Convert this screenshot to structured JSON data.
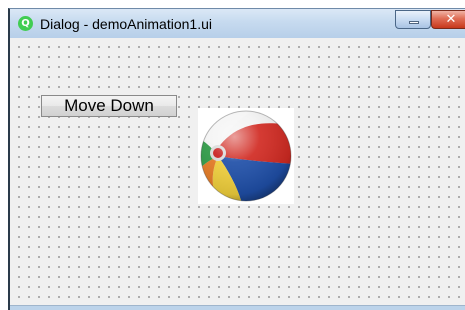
{
  "window": {
    "title": "Dialog - demoAnimation1.ui",
    "app_icon_glyph": "Qt",
    "app_icon_name": "qt-logo-icon",
    "minimize_glyph": "",
    "close_glyph": "✕"
  },
  "form": {
    "move_down_button": "Move Down",
    "ball_image": "beach-ball"
  },
  "colors": {
    "title_bar": "#c6daef",
    "close_button": "#d9533a",
    "client_background": "#f0f0f0",
    "grid_dot": "#8a8a8a"
  }
}
